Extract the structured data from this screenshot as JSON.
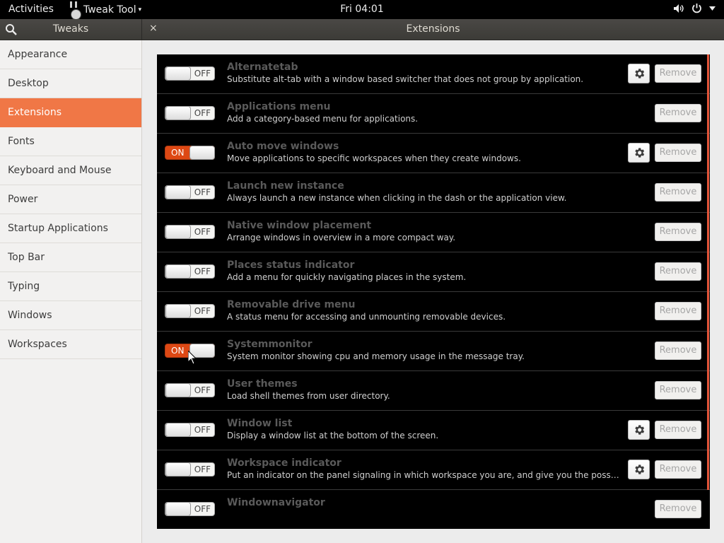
{
  "topbar": {
    "activities": "Activities",
    "app_menu": "Tweak Tool",
    "app_menu_arrow": "▾",
    "clock": "Fri 04:01",
    "icons": [
      "volume-icon",
      "power-icon",
      "chevron-down-icon"
    ]
  },
  "header": {
    "left_title": "Tweaks",
    "main_title": "Extensions",
    "close_glyph": "×"
  },
  "colors": {
    "accent": "#f07746",
    "switch_on": "#dd4814",
    "list_bg": "#000000"
  },
  "sidebar": {
    "active_index": 2,
    "items": [
      {
        "label": "Appearance"
      },
      {
        "label": "Desktop"
      },
      {
        "label": "Extensions"
      },
      {
        "label": "Fonts"
      },
      {
        "label": "Keyboard and Mouse"
      },
      {
        "label": "Power"
      },
      {
        "label": "Startup Applications"
      },
      {
        "label": "Top Bar"
      },
      {
        "label": "Typing"
      },
      {
        "label": "Windows"
      },
      {
        "label": "Workspaces"
      }
    ]
  },
  "remove_label": "Remove",
  "switch_labels": {
    "on": "ON",
    "off": "OFF"
  },
  "extensions": [
    {
      "name": "Alternatetab",
      "description": "Substitute alt-tab with a window based switcher that does not group by application.",
      "enabled": false,
      "has_settings": true
    },
    {
      "name": "Applications menu",
      "description": "Add a category-based menu for applications.",
      "enabled": false,
      "has_settings": false
    },
    {
      "name": "Auto move windows",
      "description": "Move applications to specific workspaces when they create windows.",
      "enabled": true,
      "has_settings": true
    },
    {
      "name": "Launch new instance",
      "description": "Always launch a new instance when clicking in the dash or the application view.",
      "enabled": false,
      "has_settings": false
    },
    {
      "name": "Native window placement",
      "description": "Arrange windows in overview in a more compact way.",
      "enabled": false,
      "has_settings": false
    },
    {
      "name": "Places status indicator",
      "description": "Add a menu for quickly navigating places in the system.",
      "enabled": false,
      "has_settings": false
    },
    {
      "name": "Removable drive menu",
      "description": "A status menu for accessing and unmounting removable devices.",
      "enabled": false,
      "has_settings": false
    },
    {
      "name": "Systemmonitor",
      "description": "System monitor showing cpu and memory usage in the message tray.",
      "enabled": true,
      "has_settings": false
    },
    {
      "name": "User themes",
      "description": "Load shell themes from user directory.",
      "enabled": false,
      "has_settings": false
    },
    {
      "name": "Window list",
      "description": "Display a window list at the bottom of the screen.",
      "enabled": false,
      "has_settings": true
    },
    {
      "name": "Workspace indicator",
      "description": "Put an indicator on the panel signaling in which workspace you are, and give you the possibility of …",
      "enabled": false,
      "has_settings": true
    },
    {
      "name": "Windownavigator",
      "description": "",
      "enabled": false,
      "has_settings": false
    }
  ]
}
